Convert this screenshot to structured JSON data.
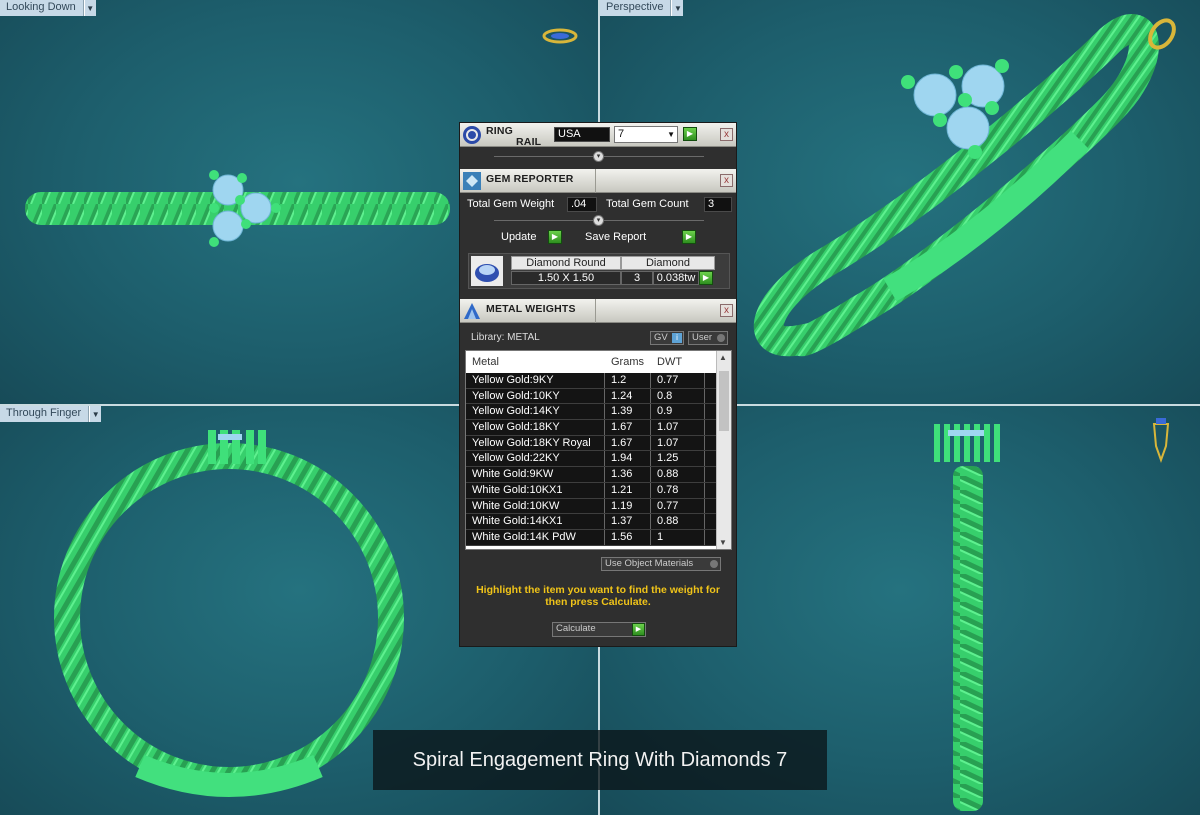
{
  "viewports": {
    "top_left": {
      "label": "Looking Down"
    },
    "top_right": {
      "label": "Perspective"
    },
    "bottom_left": {
      "label": "Through Finger"
    },
    "bottom_right": {
      "label": ""
    }
  },
  "ring_rail": {
    "title_line1": "RING",
    "title_line2": "RAIL",
    "country": "USA",
    "size": "7",
    "close": "x"
  },
  "gem_reporter": {
    "title": "GEM REPORTER",
    "total_weight_label": "Total Gem Weight",
    "total_weight_value": ".04",
    "total_count_label": "Total Gem Count",
    "total_count_value": "3",
    "update_label": "Update",
    "save_report_label": "Save Report",
    "gem_shape": "Diamond Round",
    "gem_size": "1.50 X 1.50",
    "gem_material": "Diamond",
    "gem_count": "3",
    "gem_weight": "0.038tw",
    "close": "x"
  },
  "metal_weights": {
    "title": "METAL WEIGHTS",
    "library": "Library: METAL",
    "gv_label": "GV",
    "user_label": "User",
    "columns": [
      "Metal",
      "Grams",
      "DWT"
    ],
    "rows": [
      {
        "metal": "Yellow Gold:9KY",
        "grams": "1.2",
        "dwt": "0.77"
      },
      {
        "metal": "Yellow Gold:10KY",
        "grams": "1.24",
        "dwt": "0.8"
      },
      {
        "metal": "Yellow Gold:14KY",
        "grams": "1.39",
        "dwt": "0.9"
      },
      {
        "metal": "Yellow Gold:18KY",
        "grams": "1.67",
        "dwt": "1.07"
      },
      {
        "metal": "Yellow Gold:18KY Royal",
        "grams": "1.67",
        "dwt": "1.07"
      },
      {
        "metal": "Yellow Gold:22KY",
        "grams": "1.94",
        "dwt": "1.25"
      },
      {
        "metal": "White Gold:9KW",
        "grams": "1.36",
        "dwt": "0.88"
      },
      {
        "metal": "White Gold:10KX1",
        "grams": "1.21",
        "dwt": "0.78"
      },
      {
        "metal": "White Gold:10KW",
        "grams": "1.19",
        "dwt": "0.77"
      },
      {
        "metal": "White Gold:14KX1",
        "grams": "1.37",
        "dwt": "0.88"
      },
      {
        "metal": "White Gold:14K PdW",
        "grams": "1.56",
        "dwt": "1"
      }
    ],
    "use_object_materials": "Use Object Materials",
    "note": "Highlight the item you want to find the weight for then press Calculate.",
    "calculate_label": "Calculate",
    "close": "x"
  },
  "caption": "Spiral Engagement Ring With Diamonds 7",
  "colors": {
    "ring": "#3fe07a",
    "gem": "#9fd6f0",
    "background": "#1d5e6c",
    "note": "#f0c419"
  },
  "icons": [
    "ring-rail-icon",
    "gem-reporter-icon",
    "metal-weights-icon",
    "gold-ring-icon",
    "pendant-icon"
  ]
}
